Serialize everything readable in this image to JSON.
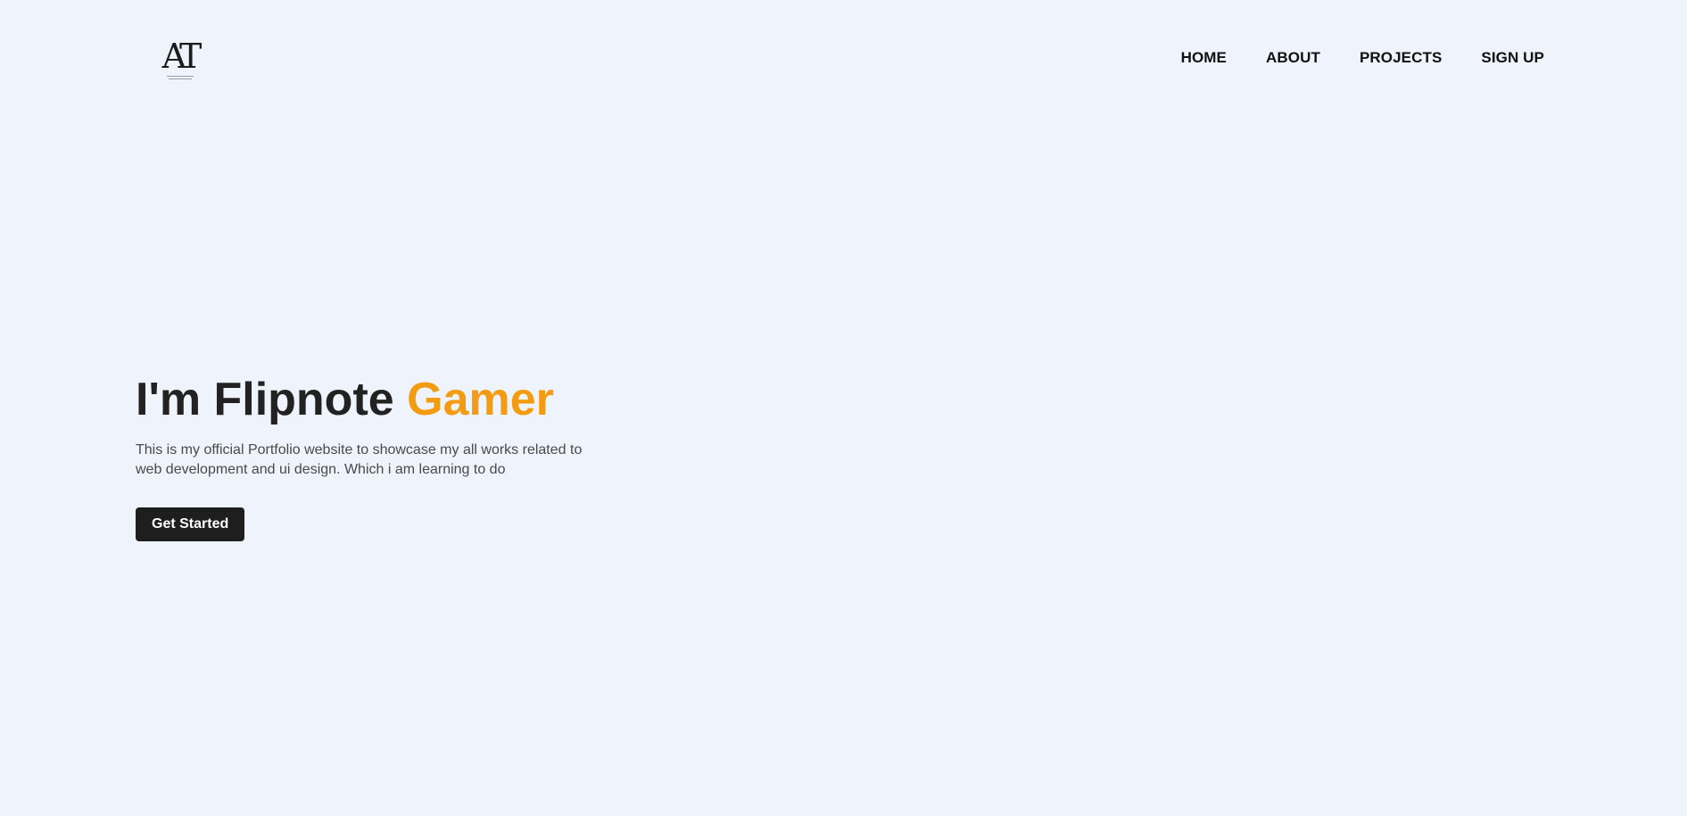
{
  "header": {
    "logo": {
      "mark": "AT"
    },
    "nav": [
      {
        "label": "HOME"
      },
      {
        "label": "ABOUT"
      },
      {
        "label": "PROJECTS"
      },
      {
        "label": "SIGN UP"
      }
    ]
  },
  "hero": {
    "title_prefix": "I'm Flipnote ",
    "title_accent": "Gamer",
    "description": "This is my official Portfolio website to showcase my all works related to web development and ui design. Which i am learning to do",
    "cta_label": "Get Started"
  },
  "colors": {
    "background": "#eef3fc",
    "accent": "#f39c12",
    "text_dark": "#222222",
    "button_bg": "#1e1e1e"
  }
}
